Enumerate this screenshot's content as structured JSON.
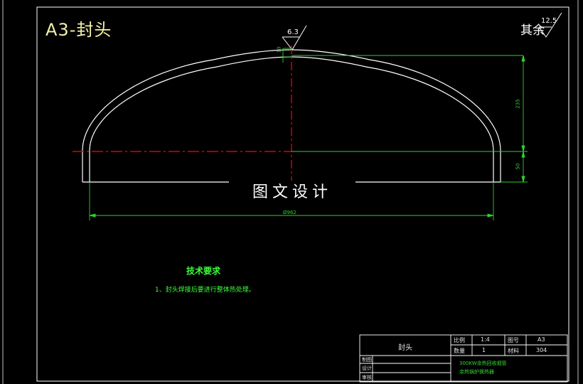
{
  "sheet": {
    "title": "A3-封头"
  },
  "roughness": {
    "label": "其余",
    "default_value": "12.5",
    "surface_value": "6.3"
  },
  "watermark": "图文设计",
  "dimensions": {
    "diameter": "Ø962",
    "dome_height": "235",
    "straight_height": "50",
    "thickness": "10"
  },
  "tech_requirements": {
    "title": "技术要求",
    "items": [
      "1、封头焊接后要进行整体热处理。"
    ]
  },
  "title_block": {
    "part_name": "封头",
    "scale_label": "比例",
    "scale_value": "1:4",
    "quantity_label": "数量",
    "quantity_value": "1",
    "sheet_label": "图号",
    "sheet_value": "A3",
    "material_label": "材料",
    "material_value": "304",
    "row_labels": [
      "制图",
      "设计",
      "审核"
    ],
    "project_line1": "300KW余热回收烟管",
    "project_line2": "余热锅炉换热器"
  },
  "colors": {
    "outline": "#ffffff",
    "centerline": "#e00000",
    "dimension": "#2fd12f",
    "text_green": "#3cff3c"
  }
}
